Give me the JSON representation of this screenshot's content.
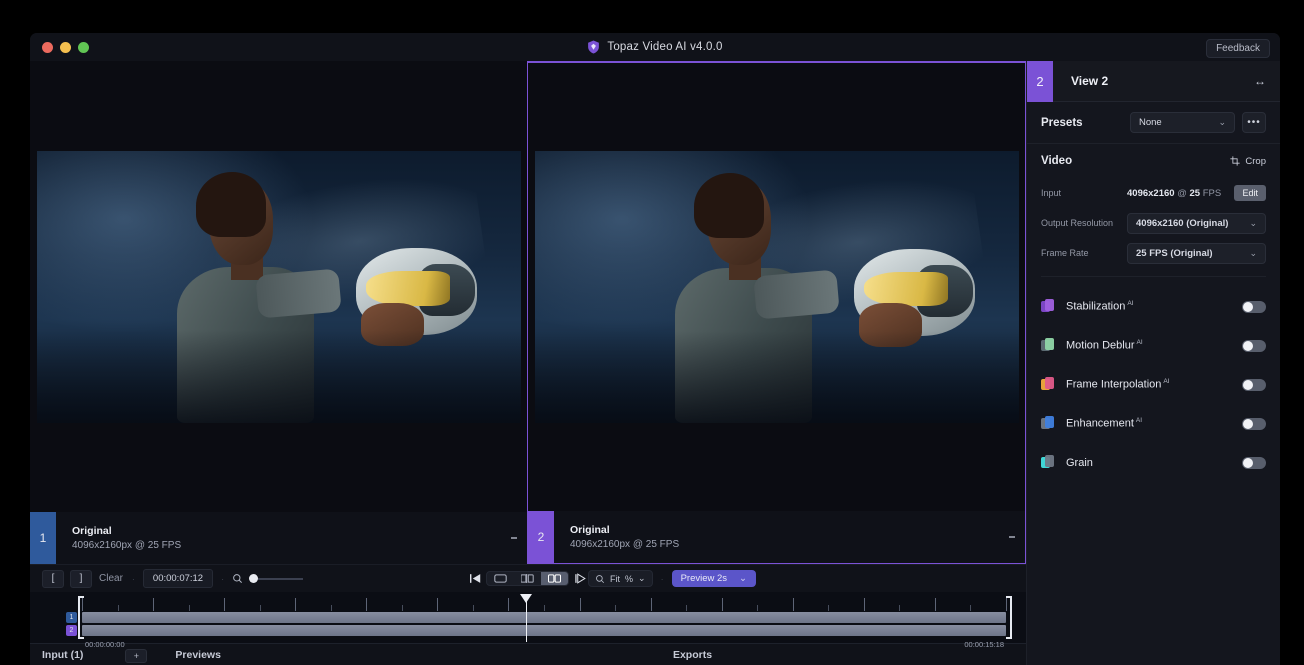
{
  "window": {
    "title": "Topaz Video AI  v4.0.0",
    "logo_icon": "topaz-shield-icon",
    "feedback_label": "Feedback",
    "traffic_lights": [
      "close-button",
      "minimize-button",
      "zoom-button"
    ]
  },
  "viewers": [
    {
      "index": "1",
      "title": "Original",
      "subtitle": "4096x2160px @ 25 FPS",
      "accent": "#2f5a9c",
      "menu_icon": "kebab-menu-icon",
      "selected": false
    },
    {
      "index": "2",
      "title": "Original",
      "subtitle": "4096x2160px @ 25 FPS",
      "accent": "#7b52d6",
      "menu_icon": "kebab-menu-icon",
      "selected": true
    }
  ],
  "transport": {
    "in_point_label": "[",
    "out_point_label": "]",
    "clear_label": "Clear",
    "timecode": "00:00:07:12",
    "zoom_icon": "magnifier-icon",
    "playback": {
      "skip_start": "skip-to-start-icon",
      "step_back": "step-backward-icon",
      "play": "play-icon",
      "step_forward": "step-forward-icon"
    },
    "view_modes": [
      "single-view-icon",
      "split-view-icon",
      "side-by-side-icon"
    ],
    "active_view_mode": "side-by-side-icon",
    "fit_label": "Fit",
    "fit_unit": "%",
    "preview_label": "Preview 2s",
    "preview_color": "#5b55c9"
  },
  "timeline": {
    "start_time": "00:00:00:00",
    "end_time": "00:00:15:18",
    "tracks": [
      {
        "badge": "1",
        "accent": "#2f5a9c"
      },
      {
        "badge": "2",
        "accent": "#7b52d6"
      }
    ],
    "playhead_percent": 48
  },
  "bottom_tabs": {
    "input_label": "Input (1)",
    "add_label": "+",
    "previews_label": "Previews",
    "exports_label": "Exports"
  },
  "sidebar": {
    "index": "2",
    "title": "View 2",
    "expand_icon": "expand-horizontal-icon",
    "presets": {
      "label": "Presets",
      "value": "None",
      "more_icon": "more-options-icon"
    },
    "video": {
      "label": "Video",
      "crop_label": "Crop",
      "crop_icon": "crop-icon",
      "input_key": "Input",
      "input_resolution": "4096x2160",
      "input_at": "@",
      "input_fps_value": "25",
      "input_fps_unit": "FPS",
      "edit_label": "Edit",
      "output_resolution_key": "Output Resolution",
      "output_resolution_value": "4096x2160 (Original)",
      "frame_rate_key": "Frame Rate",
      "frame_rate_value": "25 FPS (Original)"
    },
    "filters": [
      {
        "name": "Stabilization",
        "badge": "AI",
        "color": "#a061e0",
        "color2": "#7b46c4",
        "enabled": false
      },
      {
        "name": "Motion Deblur",
        "badge": "AI",
        "color": "#8fd6a8",
        "color2": "#5b6a72",
        "enabled": false
      },
      {
        "name": "Frame Interpolation",
        "badge": "AI",
        "color": "#e05a8a",
        "color2": "#e8a23c",
        "enabled": false
      },
      {
        "name": "Enhancement",
        "badge": "AI",
        "color": "#3f7fe0",
        "color2": "#6b7482",
        "enabled": false
      },
      {
        "name": "Grain",
        "badge": "",
        "color": "#6f7785",
        "color2": "#3fd6d6",
        "enabled": false
      }
    ]
  }
}
